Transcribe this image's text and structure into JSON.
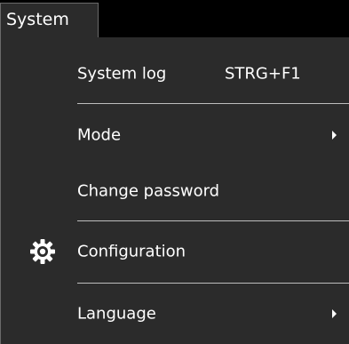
{
  "menubar": {
    "title": "System"
  },
  "menu": {
    "items": [
      {
        "label": "System log",
        "shortcut": "STRG+F1"
      },
      {
        "label": "Mode",
        "submenu": true
      },
      {
        "label": "Change password"
      },
      {
        "label": "Configuration",
        "icon": "gear-icon"
      },
      {
        "label": "Language",
        "submenu": true
      }
    ]
  },
  "colors": {
    "background": "#000000",
    "menu_background": "#2b2b2b",
    "text": "#ffffff",
    "separator": "#bdbdbd",
    "border": "#6a6a6a"
  }
}
